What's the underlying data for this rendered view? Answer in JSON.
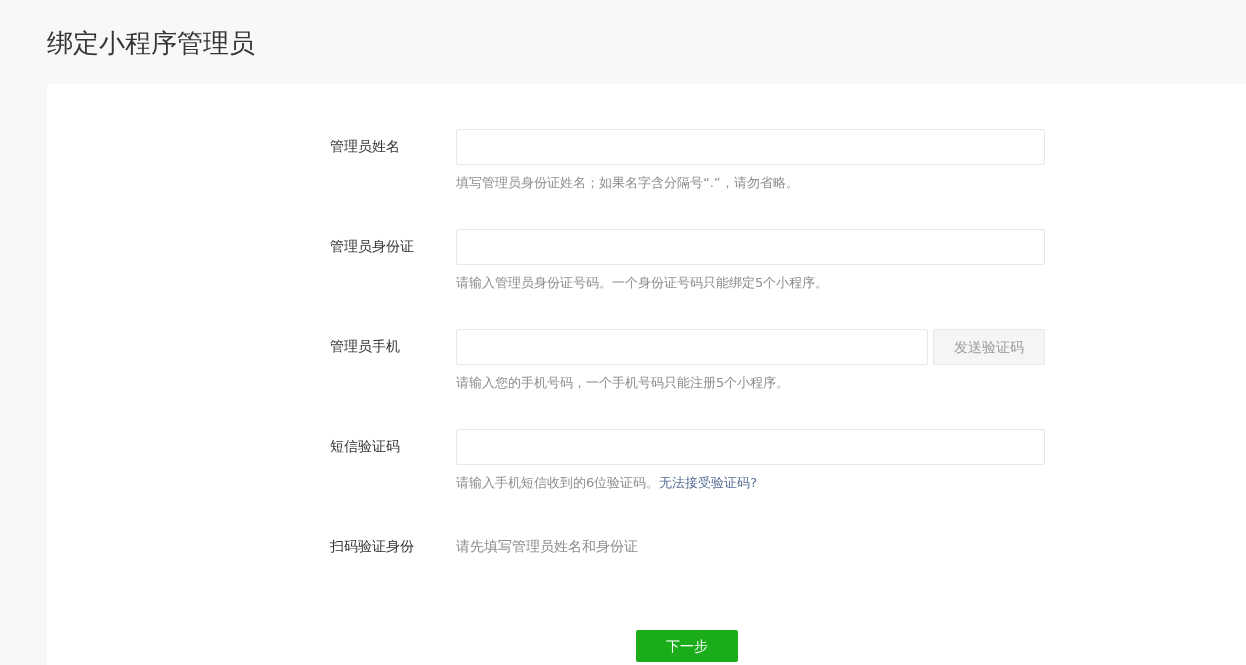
{
  "title": "绑定小程序管理员",
  "fields": [
    {
      "kind": "input",
      "label": "管理员姓名",
      "hint": "填写管理员身份证姓名；如果名字含分隔号“.”，请勿省略。"
    },
    {
      "kind": "input",
      "label": "管理员身份证",
      "hint": "请输入管理员身份证号码。一个身份证号码只能绑定5个小程序。"
    },
    {
      "kind": "input_with_button",
      "label": "管理员手机",
      "button": {
        "label": "发送验证码",
        "disabled": true
      },
      "hint": "请输入您的手机号码，一个手机号码只能注册5个小程序。"
    },
    {
      "kind": "input",
      "label": "短信验证码",
      "hint": "请输入手机短信收到的6位验证码。",
      "link": "无法接受验证码?"
    },
    {
      "kind": "text",
      "label": "扫码验证身份",
      "text": "请先填写管理员姓名和身份证"
    }
  ],
  "submit": "下一步"
}
